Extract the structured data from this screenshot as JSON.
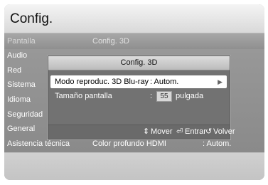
{
  "header": {
    "title": "Config."
  },
  "menu": {
    "items": [
      {
        "label": "Pantalla"
      },
      {
        "label": "Audio"
      },
      {
        "label": "Red"
      },
      {
        "label": "Sistema"
      },
      {
        "label": "Idioma"
      },
      {
        "label": "Seguridad"
      },
      {
        "label": "General"
      },
      {
        "label": "Asistencia técnica"
      }
    ],
    "submenu_title": "Config. 3D",
    "bottom_setting": {
      "label": "Color profundo HDMI",
      "value": ": Autom."
    }
  },
  "popup": {
    "title": "Config. 3D",
    "options": [
      {
        "label": "Modo reproduc. 3D Blu-ray",
        "value": ": Autom."
      },
      {
        "label": "Tamaño pantalla",
        "sep": ":",
        "value": "55",
        "unit": "pulgada"
      }
    ],
    "hints": {
      "move": "Mover",
      "enter": "Entrar",
      "back": "Volver"
    }
  }
}
